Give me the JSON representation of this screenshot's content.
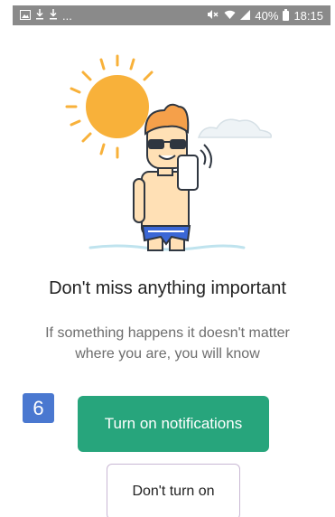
{
  "status_bar": {
    "left_icons": [
      "image-icon",
      "download-icon",
      "download-icon"
    ],
    "left_more": "...",
    "right_icons": [
      "mute-icon",
      "wifi-icon",
      "signal-icon"
    ],
    "battery": "40%",
    "time": "18:15"
  },
  "illustration": {
    "icon": "person-sunbathing-with-phone-illustration",
    "colors": {
      "sun": "#f8b13a",
      "hair": "#f5a04a",
      "skin": "#ffe0b5",
      "water": "#cfeaf2",
      "shorts": "#3a67d6"
    }
  },
  "content": {
    "headline": "Don't miss anything important",
    "subtitle": "If something happens it doesn't matter where you are, you will know"
  },
  "step_badge": "6",
  "buttons": {
    "primary": "Turn on notifications",
    "secondary": "Don't turn on"
  },
  "colors": {
    "primary": "#27a57c",
    "badge": "#4a78d0"
  }
}
